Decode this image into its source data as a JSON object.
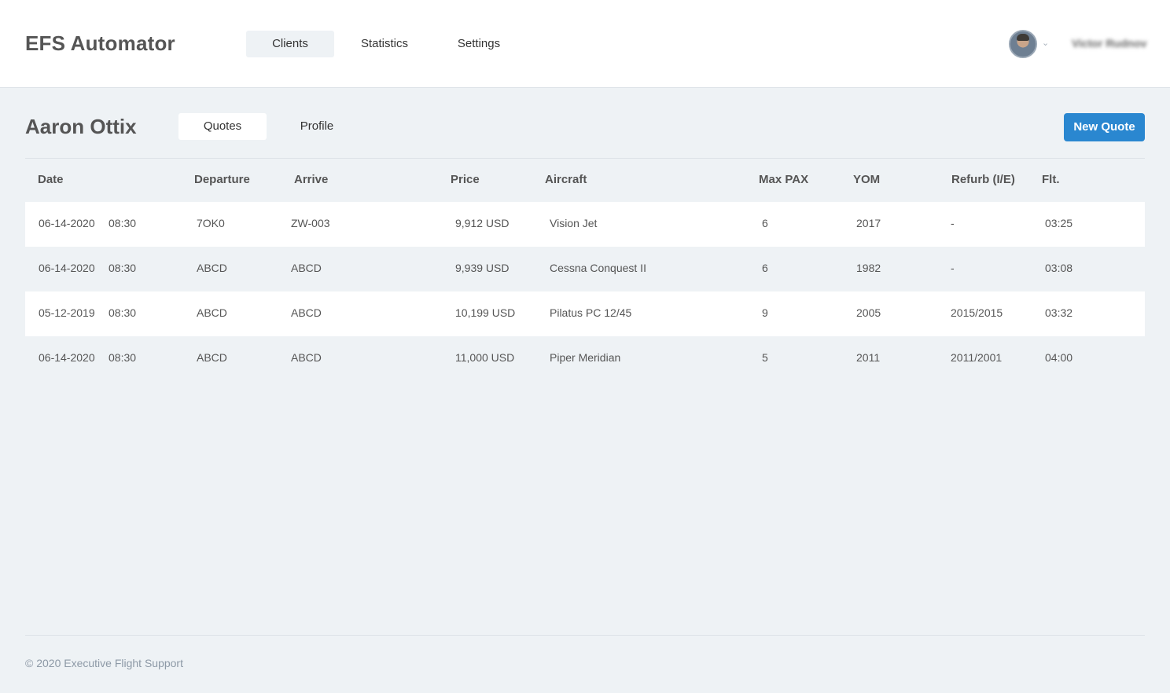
{
  "app": {
    "title": "EFS Automator"
  },
  "nav": [
    {
      "label": "Clients",
      "active": true
    },
    {
      "label": "Statistics",
      "active": false
    },
    {
      "label": "Settings",
      "active": false
    }
  ],
  "user": {
    "name": "Victor Rudnov",
    "avatar_icon": "user-avatar",
    "menu_icon": "chevron-down-icon"
  },
  "client": {
    "name": "Aaron Ottix"
  },
  "tabs": [
    {
      "label": "Quotes",
      "active": true
    },
    {
      "label": "Profile",
      "active": false
    }
  ],
  "actions": {
    "new_quote": "New Quote"
  },
  "table": {
    "headers": [
      "Date",
      "Departure",
      "Arrive",
      "Price",
      "Aircraft",
      "Max PAX",
      "YOM",
      "Refurb (I/E)",
      "Flt."
    ],
    "rows": [
      {
        "date": "06-14-2020",
        "time": "08:30",
        "departure": "7OK0",
        "arrive": "ZW-003",
        "price": "9,912 USD",
        "aircraft": "Vision Jet",
        "max_pax": "6",
        "yom": "2017",
        "refurb": "-",
        "flt": "03:25"
      },
      {
        "date": "06-14-2020",
        "time": "08:30",
        "departure": "ABCD",
        "arrive": "ABCD",
        "price": "9,939 USD",
        "aircraft": "Cessna Conquest II",
        "max_pax": "6",
        "yom": "1982",
        "refurb": "-",
        "flt": "03:08"
      },
      {
        "date": "05-12-2019",
        "time": "08:30",
        "departure": "ABCD",
        "arrive": "ABCD",
        "price": "10,199 USD",
        "aircraft": "Pilatus PC 12/45",
        "max_pax": "9",
        "yom": "2005",
        "refurb": "2015/2015",
        "flt": "03:32"
      },
      {
        "date": "06-14-2020",
        "time": "08:30",
        "departure": "ABCD",
        "arrive": "ABCD",
        "price": "11,000 USD",
        "aircraft": "Piper Meridian",
        "max_pax": "5",
        "yom": "2011",
        "refurb": "2011/2001",
        "flt": "04:00"
      }
    ]
  },
  "footer": {
    "copyright": "© 2020 Executive Flight Support"
  },
  "colors": {
    "primary": "#2a87d0",
    "background": "#eef2f5",
    "surface": "#ffffff",
    "text": "#555555",
    "muted": "#8d99a6"
  }
}
